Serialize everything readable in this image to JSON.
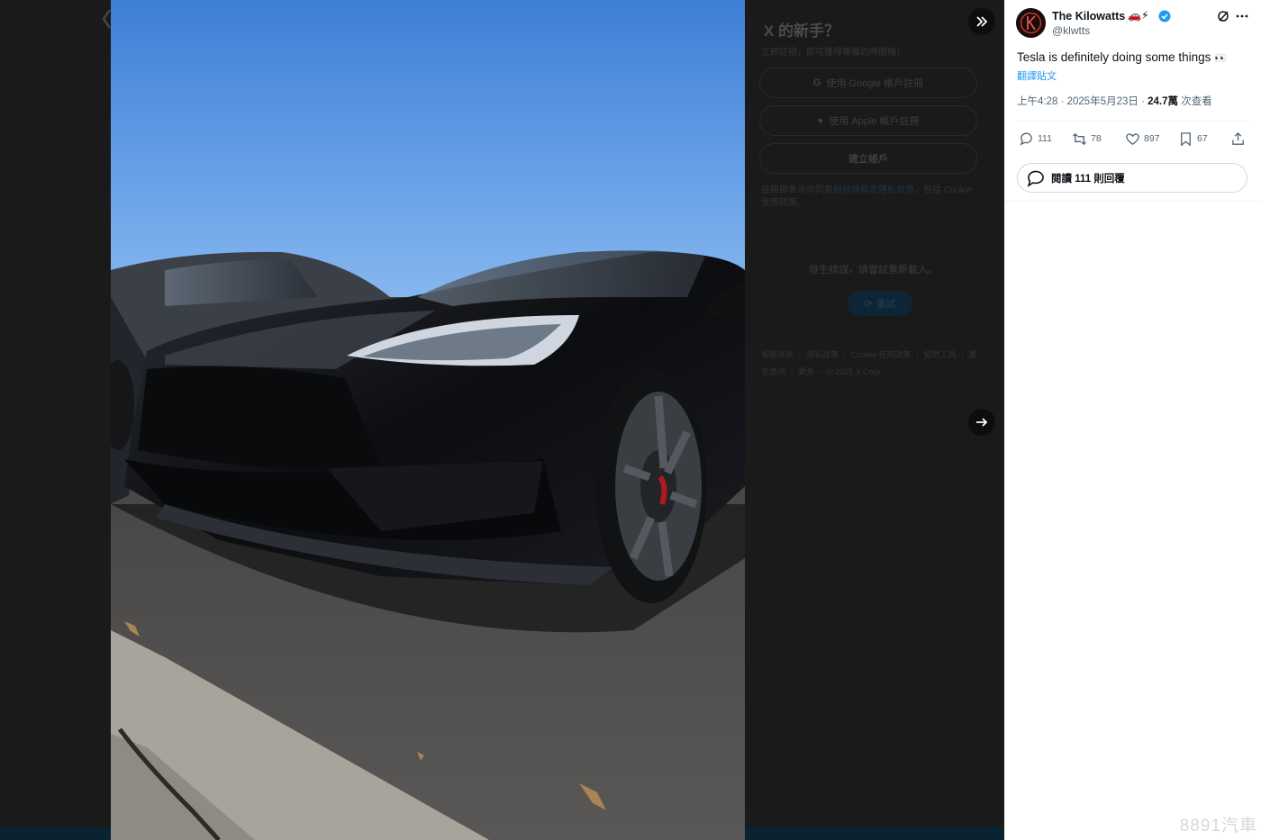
{
  "login_panel": {
    "title": "X 的新手？",
    "subtitle": "立即註冊，即可獲得專屬的時間軸！",
    "google_button": "使用 Google 帳戶註冊",
    "apple_button": "使用 Apple 帳戶註冊",
    "create_account": "建立帳戶",
    "legal_prefix": "註冊即表示你同意",
    "legal_terms": "服務條款及隱私政策",
    "legal_suffix": "，包括 Cookie 使用政策。",
    "error_text": "發生錯誤，請嘗試重新載入。",
    "retry_button": "重試",
    "footer_text": "服務條款 ｜ 隱私政策 ｜ Cookie 使用政策 ｜ 協助工具 ｜ 廣告資訊 ｜ 更多 ··· © 2025 X Corp."
  },
  "tweet": {
    "display_name": "The Kilowatts",
    "name_emoji": "🚗⚡",
    "handle": "@klwtts",
    "text": "Tesla is definitely doing some things",
    "text_emoji": "👀",
    "translate_label": "翻譯貼文",
    "time": "上午4:28",
    "date": "2025年5月23日",
    "views": "24.7萬",
    "views_label": "次查看",
    "replies": "111",
    "retweets": "78",
    "likes": "897",
    "bookmarks": "67",
    "read_replies_label": "閱讀 111 則回覆"
  },
  "watermark": "8891汽車",
  "icons": [
    "chevron-left-icon",
    "collapse-icon",
    "next-arrow-icon",
    "verified-icon",
    "grok-icon",
    "more-icon",
    "reply-icon",
    "retweet-icon",
    "like-icon",
    "bookmark-icon",
    "share-icon",
    "speech-bubble-icon",
    "google-icon",
    "apple-icon",
    "refresh-icon"
  ],
  "colors": {
    "accent": "#1d9bf0",
    "text": "#0f1419",
    "muted": "#536471",
    "backdrop": "#1a1a1a"
  }
}
